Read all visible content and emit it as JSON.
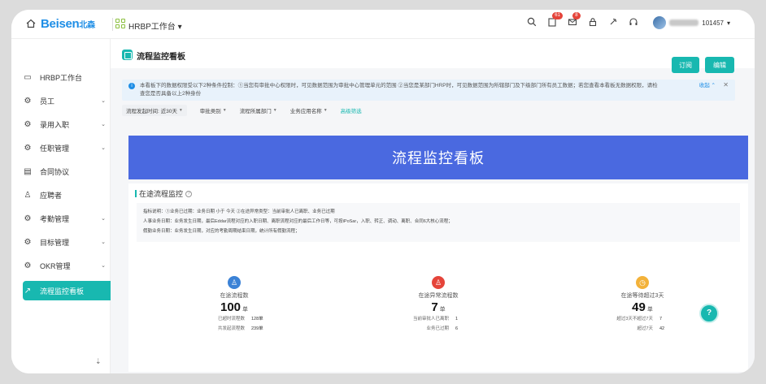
{
  "header": {
    "logo": "Beisen",
    "logo_suffix": "北森",
    "workspace": "HRBP工作台",
    "workspace_caret": "▾",
    "badges": {
      "todo": "61",
      "msg": "8"
    },
    "username_suffix": "101457",
    "user_caret": "▾"
  },
  "sidebar": {
    "items": [
      {
        "label": "HRBP工作台",
        "icon": "monitor-icon",
        "chev": ""
      },
      {
        "label": "员工",
        "icon": "gear-icon",
        "chev": "⌄"
      },
      {
        "label": "录用入职",
        "icon": "gear-icon",
        "chev": "⌄"
      },
      {
        "label": "任职管理",
        "icon": "gear-icon",
        "chev": "⌄"
      },
      {
        "label": "合同协议",
        "icon": "document-icon",
        "chev": ""
      },
      {
        "label": "应聘者",
        "icon": "person-icon",
        "chev": ""
      },
      {
        "label": "考勤管理",
        "icon": "gear-icon",
        "chev": "⌄"
      },
      {
        "label": "目标管理",
        "icon": "gear-icon",
        "chev": "⌄"
      },
      {
        "label": "OKR管理",
        "icon": "gear-icon",
        "chev": "⌄"
      },
      {
        "label": "流程监控看板",
        "icon": "chart-icon",
        "chev": ""
      }
    ],
    "bottom_icon": "⇣"
  },
  "page": {
    "title": "流程监控看板",
    "subscribe_label": "订阅",
    "edit_label": "编辑"
  },
  "notice": {
    "text": "本看板下的数据权限受以下2种条件控制：①当您有审批中心权限时，可见数据范围为审批中心管理单元的范围 ②当您是某部门HRP时，可见数据范围为所辖部门及下级部门所有员工数据；若您查看本看板无数据权限，请检查您是否具备以上2种身份",
    "collapse": "收起 ⌃",
    "close": "✕"
  },
  "filters": [
    {
      "label": "流程发起时间: 近30天",
      "selected": true
    },
    {
      "label": "审批类别",
      "selected": false
    },
    {
      "label": "流程所属部门",
      "selected": false
    },
    {
      "label": "业务应用名称",
      "selected": false
    }
  ],
  "advanced_filter": "高级筛选",
  "banner": {
    "title": "流程监控看板"
  },
  "section": {
    "title": "在途流程监控",
    "desc_lines": [
      "指标说明：①业务已过期：业务日期 小于 今天          ②在途异常类型：当前审批人已离职、业务已过期",
      "人事业务日期：业务发生日期，最后Eddar流程对应的入职日期、离职流程对应的最后工作日等，可按iPoSar，入职、转正、调动、离职、合同6大核心流程；",
      "假勤业务日期：业务发生日期，对应的考勤周期结束日期，统计所有假勤流程；"
    ]
  },
  "metrics": [
    {
      "label": "在途流程数",
      "value": "100",
      "unit": "单",
      "color": "#3b82d6",
      "icon": "person-icon",
      "rows": [
        {
          "k": "已超时流程数",
          "v": "128单"
        },
        {
          "k": "共发起流程数",
          "v": "239单"
        }
      ]
    },
    {
      "label": "在途异常流程数",
      "value": "7",
      "unit": "单",
      "color": "#e5443a",
      "icon": "person-alert-icon",
      "rows": [
        {
          "k": "当前审批人已离职",
          "v": "1"
        },
        {
          "k": "业务已过期",
          "v": "6"
        }
      ]
    },
    {
      "label": "在途等待超过3天",
      "value": "49",
      "unit": "单",
      "color": "#f3b23a",
      "icon": "clock-icon",
      "rows": [
        {
          "k": "超过3天不超过7天",
          "v": "7"
        },
        {
          "k": "超过7天",
          "v": "42"
        }
      ]
    }
  ],
  "help_label": "?"
}
